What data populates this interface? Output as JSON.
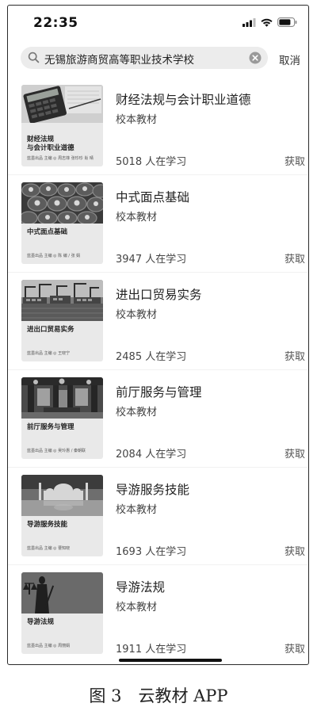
{
  "status_bar": {
    "time": "22:35",
    "icons": [
      "signal-icon",
      "wifi-icon",
      "battery-icon"
    ]
  },
  "search": {
    "query": "无锡旅游商贸高等职业技术学校",
    "cancel_label": "取消"
  },
  "results": [
    {
      "title": "财经法规与会计职业道德",
      "tag": "校本教材",
      "learners": "5018 人在学习",
      "action": "获取",
      "cover": {
        "title": "财经法规\n与会计职业道德",
        "byline": "蓝墨出品 主编 ◎ 周志菲 张珍珍 肖 晴",
        "photo": "calculator-photo"
      }
    },
    {
      "title": "中式面点基础",
      "tag": "校本教材",
      "learners": "3947 人在学习",
      "action": "获取",
      "cover": {
        "title": "中式面点基础",
        "byline": "蓝墨出品 主编 ◎ 陈 编 / 张 娟",
        "photo": "steamed-buns-photo"
      }
    },
    {
      "title": "进出口贸易实务",
      "tag": "校本教材",
      "learners": "2485 人在学习",
      "action": "获取",
      "cover": {
        "title": "进出口贸易实务",
        "byline": "蓝墨出品 主编 ◎ 王晓宁",
        "photo": "harbor-photo"
      }
    },
    {
      "title": "前厅服务与管理",
      "tag": "校本教材",
      "learners": "2084 人在学习",
      "action": "获取",
      "cover": {
        "title": "前厅服务与管理",
        "byline": "蓝墨出品 主编 ◎ 吴玲惠 / 秦朝联",
        "photo": "hotel-lobby-photo"
      }
    },
    {
      "title": "导游服务技能",
      "tag": "校本教材",
      "learners": "1693 人在学习",
      "action": "获取",
      "cover": {
        "title": "导游服务技能",
        "byline": "蓝墨出品 主编 ◎ 曹知晓",
        "photo": "mosque-photo"
      }
    },
    {
      "title": "导游法规",
      "tag": "校本教材",
      "learners": "1911 人在学习",
      "action": "获取",
      "cover": {
        "title": "导游法规",
        "byline": "蓝墨出品 主编 ◎ 周丽娟",
        "photo": "justice-statue-photo"
      }
    }
  ],
  "caption": "图 3　云教材 APP"
}
